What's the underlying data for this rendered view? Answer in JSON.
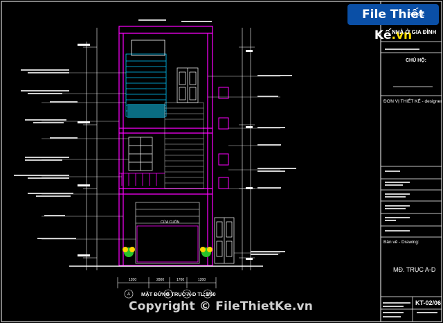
{
  "logo": {
    "text": "File Thiết Kế",
    "suffix": ".vn"
  },
  "title_block": {
    "project_header": "Project:",
    "project_name": "NHÀ Ở GIA ĐÌNH",
    "owner_label": "CHỦ HỘ:",
    "designer_label": "ĐƠN VỊ THIẾT KẾ - designer",
    "drawing_label": "Bản vẽ - Drawing:",
    "drawing_title": "MĐ. TRỤC A-D",
    "sheet_no": "KT-02/06"
  },
  "drawing": {
    "title": "MẶT ĐỨNG TRỤC A-D TL:1/50",
    "door_label": "CỬA CUỐN",
    "dimensions": [
      "1200",
      "2800",
      "1700",
      "1200"
    ],
    "axis_labels": [
      "A",
      "B",
      "C",
      "D"
    ]
  },
  "watermark": "Copyright © FileThietKe.vn",
  "colors": {
    "background": "#000000",
    "line_white": "#ffffff",
    "line_magenta": "#ff00ff",
    "line_cyan": "#00c8ff",
    "plant_yellow": "#ffd400",
    "plant_green": "#29c229"
  }
}
